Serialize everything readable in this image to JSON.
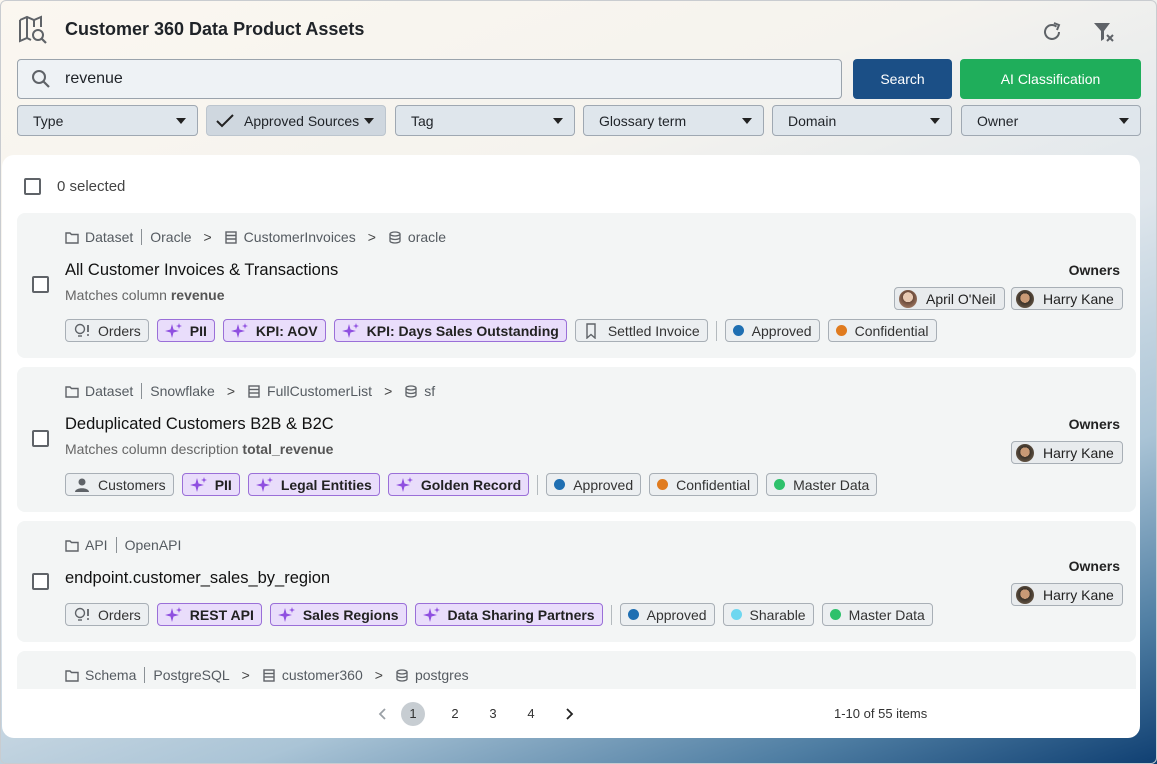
{
  "header": {
    "title": "Customer 360 Data Product Assets"
  },
  "search": {
    "value": "revenue",
    "search_label": "Search",
    "ai_label": "AI Classification"
  },
  "filters": [
    "Type",
    "Approved Sources",
    "Tag",
    "Glossary term",
    "Domain",
    "Owner"
  ],
  "selection": {
    "label": "0 selected"
  },
  "owners_label": "Owners",
  "results": [
    {
      "breadcrumb": [
        "Dataset",
        "Oracle",
        ">",
        "CustomerInvoices",
        ">",
        "oracle"
      ],
      "title": "All Customer Invoices & Transactions",
      "match_prefix": "Matches column",
      "match_term": "revenue",
      "owners": [
        "April O'Neil",
        "Harry Kane"
      ],
      "tags": [
        {
          "label": "Orders",
          "kind": "glossary"
        },
        {
          "label": "PII",
          "kind": "ai"
        },
        {
          "label": "KPI: AOV",
          "kind": "ai"
        },
        {
          "label": "KPI: Days Sales Outstanding",
          "kind": "ai"
        },
        {
          "label": "Settled Invoice",
          "kind": "bookmark"
        },
        {
          "label": "Approved",
          "kind": "status",
          "color": "#1f6fb2"
        },
        {
          "label": "Confidential",
          "kind": "status",
          "color": "#e07b1f"
        }
      ]
    },
    {
      "breadcrumb": [
        "Dataset",
        "Snowflake",
        ">",
        "FullCustomerList",
        ">",
        "sf"
      ],
      "title": "Deduplicated Customers B2B & B2C",
      "match_prefix": "Matches column description",
      "match_term": "total_revenue",
      "owners": [
        "Harry Kane"
      ],
      "tags": [
        {
          "label": "Customers",
          "kind": "person"
        },
        {
          "label": "PII",
          "kind": "ai"
        },
        {
          "label": "Legal Entities",
          "kind": "ai"
        },
        {
          "label": "Golden Record",
          "kind": "ai"
        },
        {
          "label": "Approved",
          "kind": "status",
          "color": "#1f6fb2"
        },
        {
          "label": "Confidential",
          "kind": "status",
          "color": "#e07b1f"
        },
        {
          "label": "Master Data",
          "kind": "status",
          "color": "#2ec16b"
        }
      ]
    },
    {
      "breadcrumb": [
        "API",
        "OpenAPI"
      ],
      "title": "endpoint.customer_sales_by_region",
      "owners": [
        "Harry Kane"
      ],
      "tags": [
        {
          "label": "Orders",
          "kind": "glossary"
        },
        {
          "label": "REST API",
          "kind": "ai"
        },
        {
          "label": "Sales Regions",
          "kind": "ai"
        },
        {
          "label": "Data Sharing Partners",
          "kind": "ai"
        },
        {
          "label": "Approved",
          "kind": "status",
          "color": "#1f6fb2"
        },
        {
          "label": "Sharable",
          "kind": "status",
          "color": "#6ed7f0"
        },
        {
          "label": "Master Data",
          "kind": "status",
          "color": "#2ec16b"
        }
      ]
    },
    {
      "breadcrumb": [
        "Schema",
        "PostgreSQL",
        ">",
        "customer360",
        ">",
        "postgres"
      ]
    }
  ],
  "pagination": {
    "pages": [
      "1",
      "2",
      "3",
      "4"
    ],
    "current": "1",
    "info": "1-10 of 55 items"
  }
}
